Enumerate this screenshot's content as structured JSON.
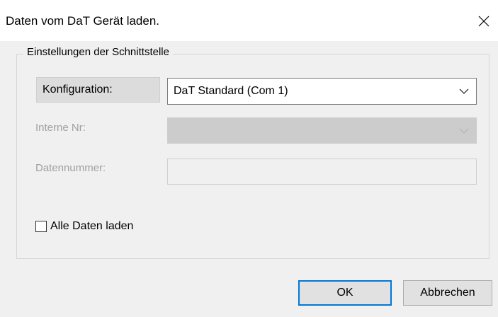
{
  "window": {
    "title": "Daten vom DaT Gerät laden."
  },
  "group": {
    "legend": "Einstellungen der Schnittstelle",
    "konfiguration_label": "Konfiguration:",
    "konfiguration_value": "DaT Standard (Com 1)",
    "interne_nr_label": "Interne Nr:",
    "interne_nr_value": "",
    "datennummer_label": "Datennummer:",
    "datennummer_value": ""
  },
  "options": {
    "alle_daten_label": "Alle Daten laden",
    "alle_daten_checked": false
  },
  "buttons": {
    "ok_label": "OK",
    "cancel_label": "Abbrechen"
  },
  "icons": {
    "close": "close-icon",
    "dropdown": "chevron-down-icon"
  },
  "colors": {
    "accent": "#0078d7",
    "disabled_text": "#a0a0a0",
    "disabled_fill": "#cccccc"
  }
}
